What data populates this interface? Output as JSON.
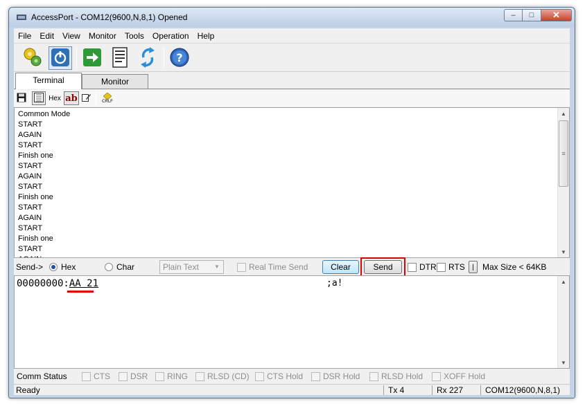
{
  "window": {
    "title": "AccessPort - COM12(9600,N,8,1) Opened",
    "controls": {
      "minimize": "–",
      "maximize": "□",
      "close": "✕"
    }
  },
  "menu": [
    "File",
    "Edit",
    "View",
    "Monitor",
    "Tools",
    "Operation",
    "Help"
  ],
  "toolbar": {
    "buttons": [
      {
        "name": "settings-gear-icon"
      },
      {
        "name": "power-icon",
        "pressed": true
      },
      {
        "name": "green-arrow-icon"
      },
      {
        "name": "document-icon"
      },
      {
        "name": "refresh-icon"
      },
      {
        "name": "help-icon"
      }
    ]
  },
  "tabs": [
    {
      "label": "Terminal",
      "active": true
    },
    {
      "label": "Monitor",
      "active": false
    }
  ],
  "subtoolbar": {
    "hex_label": "Hex",
    "ab_label": "ab",
    "crlf_label": "CRLF"
  },
  "terminal": {
    "lines": [
      "Common Mode",
      "START",
      "AGAIN",
      "START",
      "Finish one",
      "START",
      "AGAIN",
      "START",
      "Finish one",
      "START",
      "AGAIN",
      "START",
      "Finish one",
      "START",
      "AGAIN"
    ]
  },
  "sendbar": {
    "send_label": "Send->",
    "hex_option": "Hex",
    "char_option": "Char",
    "mode_selected": "Hex",
    "format_select": "Plain Text",
    "realtime_label": "Real Time Send",
    "clear_label": "Clear",
    "send_button": "Send",
    "dtr_label": "DTR",
    "rts_label": "RTS",
    "small_button": "|",
    "max_size": "Max Size < 64KB"
  },
  "editor": {
    "address": "00000000:",
    "data": "AA 21",
    "ascii": ";a!"
  },
  "comm_status": {
    "label": "Comm Status",
    "items": [
      "CTS",
      "DSR",
      "RING",
      "RLSD (CD)",
      "CTS Hold",
      "DSR Hold",
      "RLSD Hold",
      "XOFF Hold"
    ]
  },
  "statusbar": {
    "ready": "Ready",
    "tx": "Tx 4",
    "rx": "Rx 227",
    "port": "COM12(9600,N,8,1)"
  },
  "colors": {
    "highlight": "#e00000",
    "title_bar": "#c4d3e6"
  }
}
